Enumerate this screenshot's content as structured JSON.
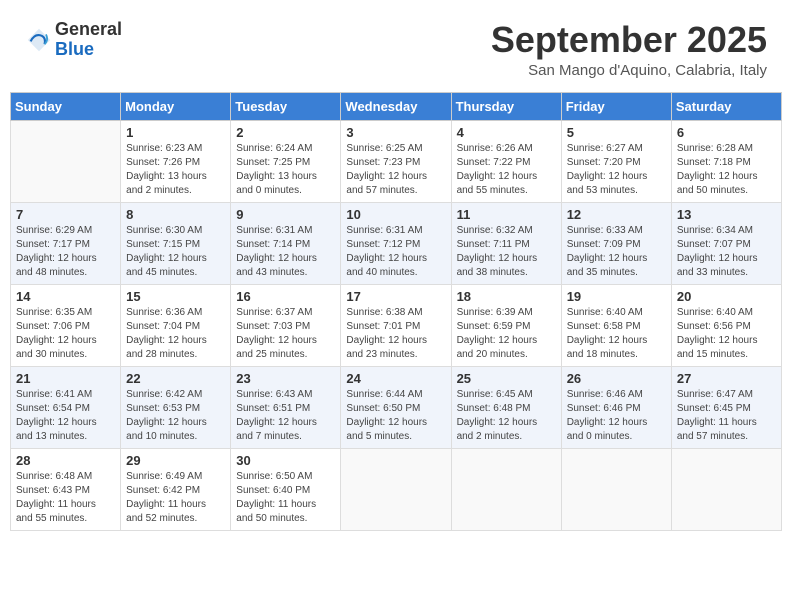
{
  "header": {
    "logo_line1": "General",
    "logo_line2": "Blue",
    "month_title": "September 2025",
    "subtitle": "San Mango d'Aquino, Calabria, Italy"
  },
  "weekdays": [
    "Sunday",
    "Monday",
    "Tuesday",
    "Wednesday",
    "Thursday",
    "Friday",
    "Saturday"
  ],
  "weeks": [
    [
      {
        "day": "",
        "sunrise": "",
        "sunset": "",
        "daylight": ""
      },
      {
        "day": "1",
        "sunrise": "Sunrise: 6:23 AM",
        "sunset": "Sunset: 7:26 PM",
        "daylight": "Daylight: 13 hours and 2 minutes."
      },
      {
        "day": "2",
        "sunrise": "Sunrise: 6:24 AM",
        "sunset": "Sunset: 7:25 PM",
        "daylight": "Daylight: 13 hours and 0 minutes."
      },
      {
        "day": "3",
        "sunrise": "Sunrise: 6:25 AM",
        "sunset": "Sunset: 7:23 PM",
        "daylight": "Daylight: 12 hours and 57 minutes."
      },
      {
        "day": "4",
        "sunrise": "Sunrise: 6:26 AM",
        "sunset": "Sunset: 7:22 PM",
        "daylight": "Daylight: 12 hours and 55 minutes."
      },
      {
        "day": "5",
        "sunrise": "Sunrise: 6:27 AM",
        "sunset": "Sunset: 7:20 PM",
        "daylight": "Daylight: 12 hours and 53 minutes."
      },
      {
        "day": "6",
        "sunrise": "Sunrise: 6:28 AM",
        "sunset": "Sunset: 7:18 PM",
        "daylight": "Daylight: 12 hours and 50 minutes."
      }
    ],
    [
      {
        "day": "7",
        "sunrise": "Sunrise: 6:29 AM",
        "sunset": "Sunset: 7:17 PM",
        "daylight": "Daylight: 12 hours and 48 minutes."
      },
      {
        "day": "8",
        "sunrise": "Sunrise: 6:30 AM",
        "sunset": "Sunset: 7:15 PM",
        "daylight": "Daylight: 12 hours and 45 minutes."
      },
      {
        "day": "9",
        "sunrise": "Sunrise: 6:31 AM",
        "sunset": "Sunset: 7:14 PM",
        "daylight": "Daylight: 12 hours and 43 minutes."
      },
      {
        "day": "10",
        "sunrise": "Sunrise: 6:31 AM",
        "sunset": "Sunset: 7:12 PM",
        "daylight": "Daylight: 12 hours and 40 minutes."
      },
      {
        "day": "11",
        "sunrise": "Sunrise: 6:32 AM",
        "sunset": "Sunset: 7:11 PM",
        "daylight": "Daylight: 12 hours and 38 minutes."
      },
      {
        "day": "12",
        "sunrise": "Sunrise: 6:33 AM",
        "sunset": "Sunset: 7:09 PM",
        "daylight": "Daylight: 12 hours and 35 minutes."
      },
      {
        "day": "13",
        "sunrise": "Sunrise: 6:34 AM",
        "sunset": "Sunset: 7:07 PM",
        "daylight": "Daylight: 12 hours and 33 minutes."
      }
    ],
    [
      {
        "day": "14",
        "sunrise": "Sunrise: 6:35 AM",
        "sunset": "Sunset: 7:06 PM",
        "daylight": "Daylight: 12 hours and 30 minutes."
      },
      {
        "day": "15",
        "sunrise": "Sunrise: 6:36 AM",
        "sunset": "Sunset: 7:04 PM",
        "daylight": "Daylight: 12 hours and 28 minutes."
      },
      {
        "day": "16",
        "sunrise": "Sunrise: 6:37 AM",
        "sunset": "Sunset: 7:03 PM",
        "daylight": "Daylight: 12 hours and 25 minutes."
      },
      {
        "day": "17",
        "sunrise": "Sunrise: 6:38 AM",
        "sunset": "Sunset: 7:01 PM",
        "daylight": "Daylight: 12 hours and 23 minutes."
      },
      {
        "day": "18",
        "sunrise": "Sunrise: 6:39 AM",
        "sunset": "Sunset: 6:59 PM",
        "daylight": "Daylight: 12 hours and 20 minutes."
      },
      {
        "day": "19",
        "sunrise": "Sunrise: 6:40 AM",
        "sunset": "Sunset: 6:58 PM",
        "daylight": "Daylight: 12 hours and 18 minutes."
      },
      {
        "day": "20",
        "sunrise": "Sunrise: 6:40 AM",
        "sunset": "Sunset: 6:56 PM",
        "daylight": "Daylight: 12 hours and 15 minutes."
      }
    ],
    [
      {
        "day": "21",
        "sunrise": "Sunrise: 6:41 AM",
        "sunset": "Sunset: 6:54 PM",
        "daylight": "Daylight: 12 hours and 13 minutes."
      },
      {
        "day": "22",
        "sunrise": "Sunrise: 6:42 AM",
        "sunset": "Sunset: 6:53 PM",
        "daylight": "Daylight: 12 hours and 10 minutes."
      },
      {
        "day": "23",
        "sunrise": "Sunrise: 6:43 AM",
        "sunset": "Sunset: 6:51 PM",
        "daylight": "Daylight: 12 hours and 7 minutes."
      },
      {
        "day": "24",
        "sunrise": "Sunrise: 6:44 AM",
        "sunset": "Sunset: 6:50 PM",
        "daylight": "Daylight: 12 hours and 5 minutes."
      },
      {
        "day": "25",
        "sunrise": "Sunrise: 6:45 AM",
        "sunset": "Sunset: 6:48 PM",
        "daylight": "Daylight: 12 hours and 2 minutes."
      },
      {
        "day": "26",
        "sunrise": "Sunrise: 6:46 AM",
        "sunset": "Sunset: 6:46 PM",
        "daylight": "Daylight: 12 hours and 0 minutes."
      },
      {
        "day": "27",
        "sunrise": "Sunrise: 6:47 AM",
        "sunset": "Sunset: 6:45 PM",
        "daylight": "Daylight: 11 hours and 57 minutes."
      }
    ],
    [
      {
        "day": "28",
        "sunrise": "Sunrise: 6:48 AM",
        "sunset": "Sunset: 6:43 PM",
        "daylight": "Daylight: 11 hours and 55 minutes."
      },
      {
        "day": "29",
        "sunrise": "Sunrise: 6:49 AM",
        "sunset": "Sunset: 6:42 PM",
        "daylight": "Daylight: 11 hours and 52 minutes."
      },
      {
        "day": "30",
        "sunrise": "Sunrise: 6:50 AM",
        "sunset": "Sunset: 6:40 PM",
        "daylight": "Daylight: 11 hours and 50 minutes."
      },
      {
        "day": "",
        "sunrise": "",
        "sunset": "",
        "daylight": ""
      },
      {
        "day": "",
        "sunrise": "",
        "sunset": "",
        "daylight": ""
      },
      {
        "day": "",
        "sunrise": "",
        "sunset": "",
        "daylight": ""
      },
      {
        "day": "",
        "sunrise": "",
        "sunset": "",
        "daylight": ""
      }
    ]
  ]
}
